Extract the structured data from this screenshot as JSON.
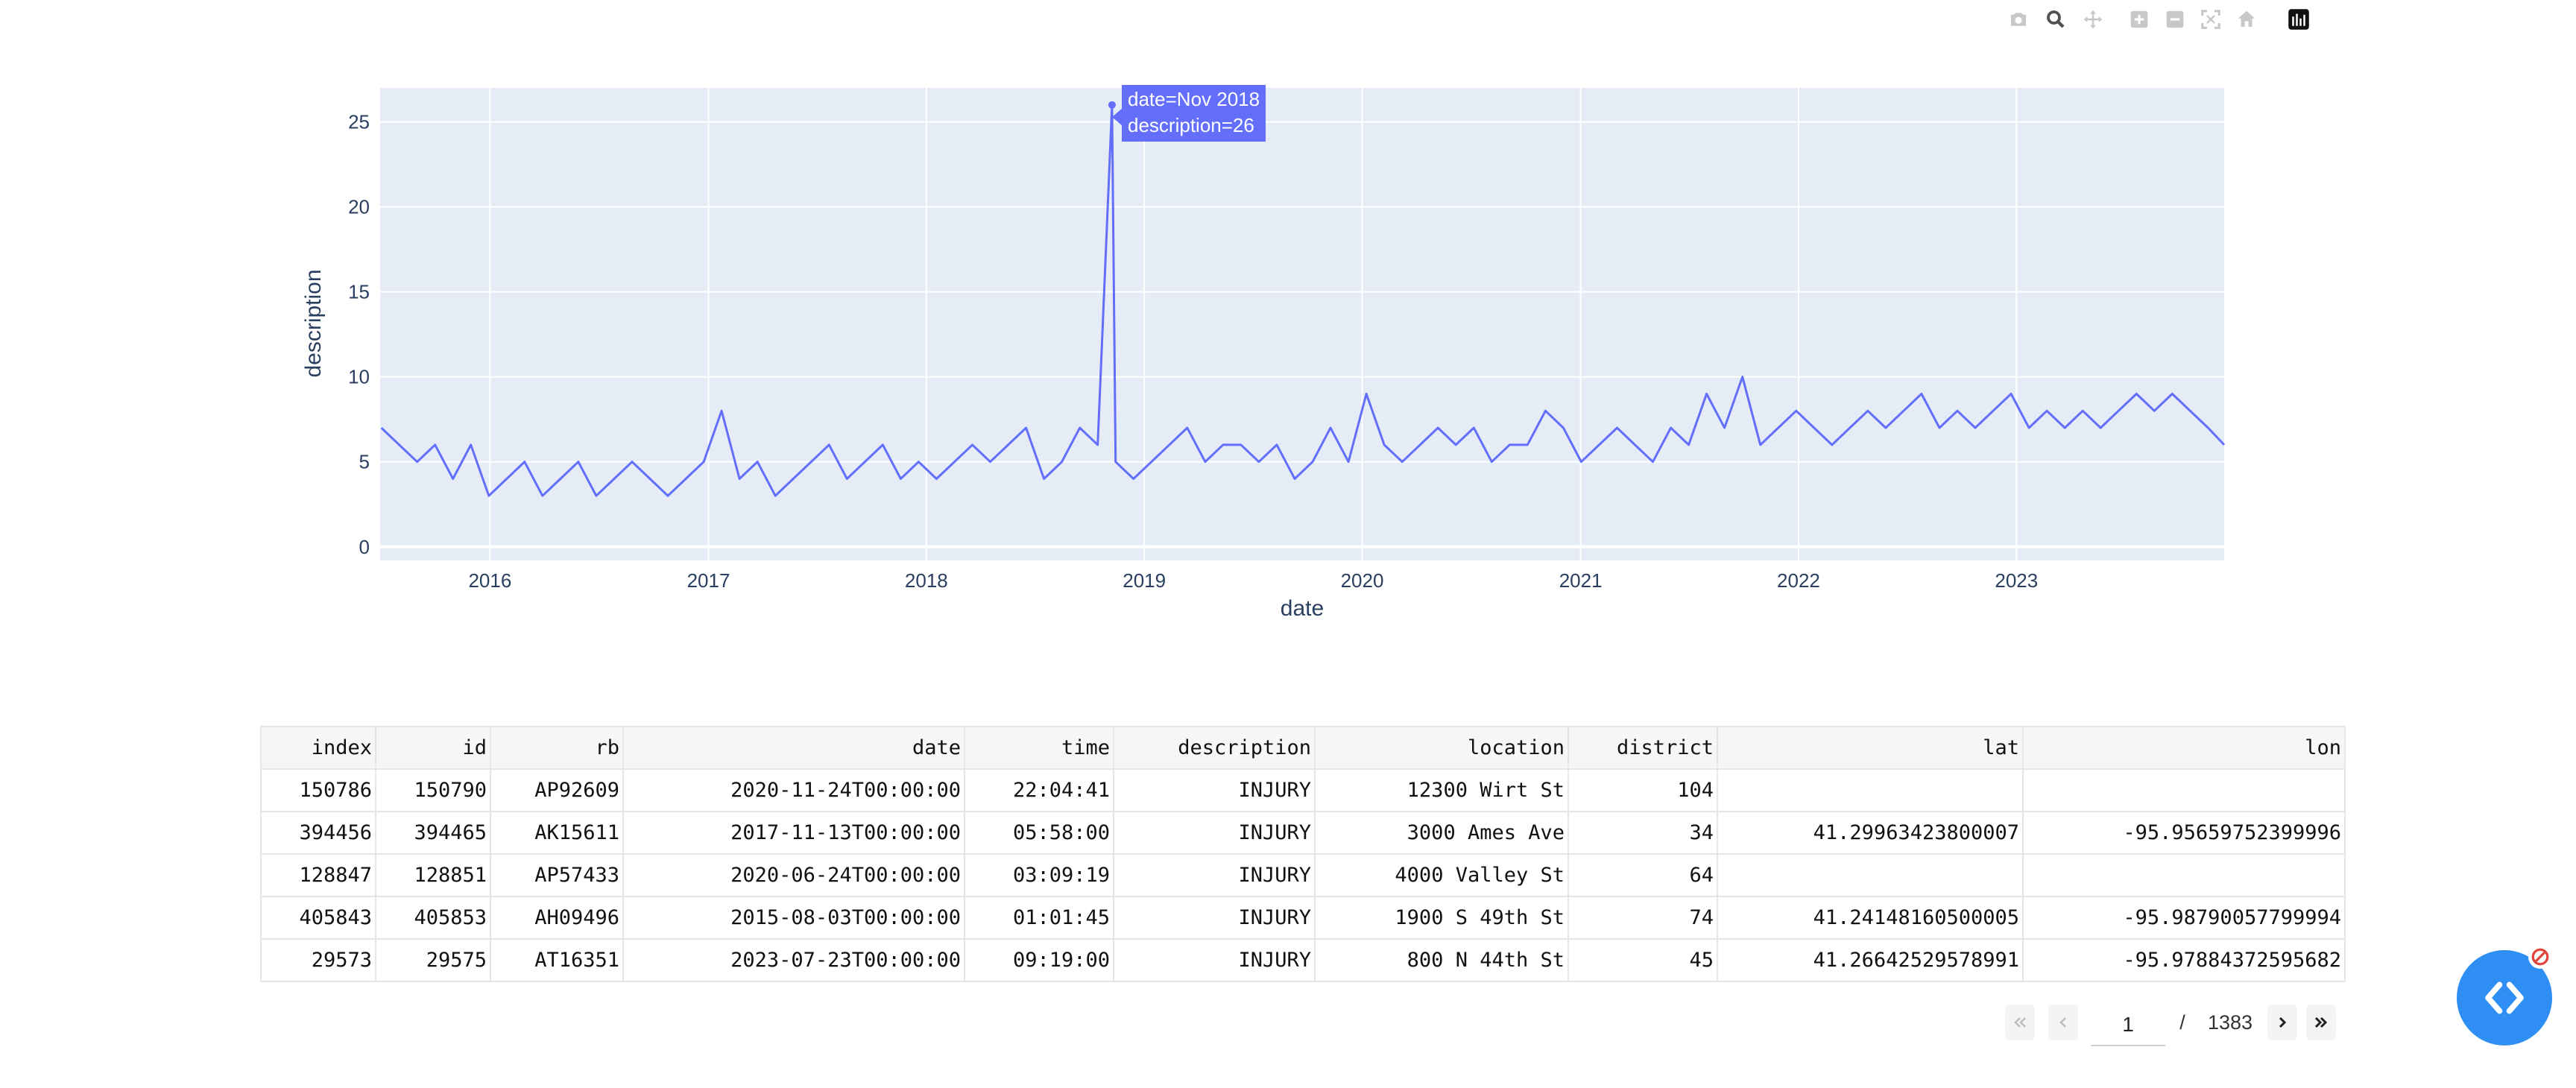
{
  "modebar": {
    "icons": [
      "camera-icon",
      "zoom-icon",
      "pan-icon",
      "zoom-in-icon",
      "zoom-out-icon",
      "autoscale-icon",
      "reset-axes-icon",
      "plotly-logo-icon"
    ]
  },
  "chart_data": {
    "type": "line",
    "color": "#636efa",
    "plot_bgcolor": "#e5ecf6",
    "xlabel": "date",
    "ylabel": "description",
    "x_range": [
      "2015-07-01",
      "2023-12-15"
    ],
    "ylim": [
      -0.8,
      27
    ],
    "y_ticks": [
      0,
      5,
      10,
      15,
      20,
      25
    ],
    "x_ticks": [
      {
        "label": "2016",
        "date": "2016-01-01"
      },
      {
        "label": "2017",
        "date": "2017-01-01"
      },
      {
        "label": "2018",
        "date": "2018-01-01"
      },
      {
        "label": "2019",
        "date": "2019-01-01"
      },
      {
        "label": "2020",
        "date": "2020-01-01"
      },
      {
        "label": "2021",
        "date": "2021-01-01"
      },
      {
        "label": "2022",
        "date": "2022-01-01"
      },
      {
        "label": "2023",
        "date": "2023-01-01"
      }
    ],
    "grid": true,
    "series": [
      {
        "x": [
          "2015-07-03",
          "2015-08-02",
          "2015-09-01",
          "2015-10-01",
          "2015-10-31",
          "2015-11-30",
          "2015-12-30",
          "2016-01-29",
          "2016-02-28",
          "2016-03-29",
          "2016-04-28",
          "2016-05-28",
          "2016-06-27",
          "2016-07-27",
          "2016-08-26",
          "2016-09-25",
          "2016-10-25",
          "2016-11-24",
          "2016-12-24",
          "2017-01-23",
          "2017-02-22",
          "2017-03-24",
          "2017-04-23",
          "2017-05-23",
          "2017-06-22",
          "2017-07-22",
          "2017-08-21",
          "2017-09-20",
          "2017-10-20",
          "2017-11-19",
          "2017-12-19",
          "2018-01-18",
          "2018-02-17",
          "2018-03-19",
          "2018-04-18",
          "2018-05-18",
          "2018-06-17",
          "2018-07-17",
          "2018-08-16",
          "2018-09-15",
          "2018-10-15",
          "2018-11-08",
          "2018-11-14",
          "2018-12-14",
          "2019-01-13",
          "2019-02-12",
          "2019-03-14",
          "2019-04-13",
          "2019-05-13",
          "2019-06-12",
          "2019-07-12",
          "2019-08-11",
          "2019-09-10",
          "2019-10-10",
          "2019-11-09",
          "2019-12-09",
          "2020-01-08",
          "2020-02-07",
          "2020-03-08",
          "2020-04-07",
          "2020-05-07",
          "2020-06-06",
          "2020-07-06",
          "2020-08-05",
          "2020-09-04",
          "2020-10-04",
          "2020-11-03",
          "2020-12-03",
          "2021-01-02",
          "2021-02-01",
          "2021-03-03",
          "2021-04-02",
          "2021-05-02",
          "2021-06-01",
          "2021-07-01",
          "2021-07-31",
          "2021-08-30",
          "2021-09-29",
          "2021-10-29",
          "2021-11-28",
          "2021-12-28",
          "2022-01-27",
          "2022-02-26",
          "2022-03-28",
          "2022-04-27",
          "2022-05-27",
          "2022-06-26",
          "2022-07-26",
          "2022-08-25",
          "2022-09-24",
          "2022-10-24",
          "2022-11-23",
          "2022-12-23",
          "2023-01-22",
          "2023-02-21",
          "2023-03-23",
          "2023-04-22",
          "2023-05-22",
          "2023-06-21",
          "2023-07-21",
          "2023-08-20",
          "2023-09-19",
          "2023-10-19",
          "2023-11-18",
          "2023-12-15"
        ],
        "y": [
          7,
          6,
          5,
          6,
          4,
          6,
          3,
          4,
          5,
          3,
          4,
          5,
          3,
          4,
          5,
          4,
          3,
          4,
          5,
          8,
          4,
          5,
          3,
          4,
          5,
          6,
          4,
          5,
          6,
          4,
          5,
          4,
          5,
          6,
          5,
          6,
          7,
          4,
          5,
          7,
          6,
          26,
          5,
          4,
          5,
          6,
          7,
          5,
          6,
          6,
          5,
          6,
          4,
          5,
          7,
          5,
          9,
          6,
          5,
          6,
          7,
          6,
          7,
          5,
          6,
          6,
          8,
          7,
          5,
          6,
          7,
          6,
          5,
          7,
          6,
          9,
          7,
          10,
          6,
          7,
          8,
          7,
          6,
          7,
          8,
          7,
          8,
          9,
          7,
          8,
          7,
          8,
          9,
          7,
          8,
          7,
          8,
          7,
          8,
          9,
          8,
          9,
          8,
          7,
          6
        ]
      }
    ]
  },
  "tooltip": {
    "line1": "date=Nov 2018",
    "line2": "description=26"
  },
  "table": {
    "columns": [
      "index",
      "id",
      "rb",
      "date",
      "time",
      "description",
      "location",
      "district",
      "lat",
      "lon"
    ],
    "rows": [
      [
        "150786",
        "150790",
        "AP92609",
        "2020-11-24T00:00:00",
        "22:04:41",
        "INJURY",
        "12300 Wirt St",
        "104",
        "",
        ""
      ],
      [
        "394456",
        "394465",
        "AK15611",
        "2017-11-13T00:00:00",
        "05:58:00",
        "INJURY",
        "3000 Ames Ave",
        "34",
        "41.29963423800007",
        "-95.95659752399996"
      ],
      [
        "128847",
        "128851",
        "AP57433",
        "2020-06-24T00:00:00",
        "03:09:19",
        "INJURY",
        "4000 Valley St",
        "64",
        "",
        ""
      ],
      [
        "405843",
        "405853",
        "AH09496",
        "2015-08-03T00:00:00",
        "01:01:45",
        "INJURY",
        "1900 S 49th St",
        "74",
        "41.24148160500005",
        "-95.98790057799994"
      ],
      [
        "29573",
        "29575",
        "AT16351",
        "2023-07-23T00:00:00",
        "09:19:00",
        "INJURY",
        "800 N 44th St",
        "45",
        "41.26642529578991",
        "-95.97884372595682"
      ]
    ]
  },
  "pager": {
    "current_page": "1",
    "separator": "/",
    "total_pages": "1383"
  },
  "fab": {
    "icon": "code-icon",
    "badge_icon": "no-entry-icon"
  }
}
